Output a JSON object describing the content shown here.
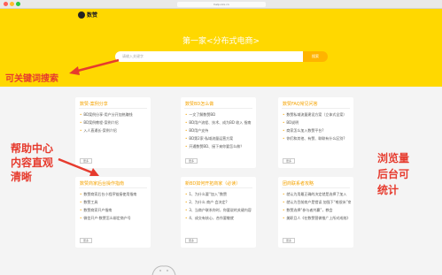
{
  "browser": {
    "url": "help.xxx.cn"
  },
  "header": {
    "logo_text": "数赞"
  },
  "hero": {
    "title": "第一家<分布式电商>",
    "search_placeholder": "请输入关键字",
    "search_button": "搜索"
  },
  "cards": [
    {
      "title": "数赞-案例分享",
      "items": [
        "BD案例分享-用户分开加热赚钱",
        "BD案例教程-案例介绍",
        "入人直通长-案例介绍"
      ],
      "more": "更多"
    },
    {
      "title": "数赞BD怎么做",
      "items": [
        "一文了解数赞BD",
        "BD用户流程、技术、成为BD 收入 指南",
        "BD用户支持",
        "BD第2家-私域流量运营方案",
        "开通数赞BD、接下来你要怎么做？"
      ],
      "more": "更多"
    },
    {
      "title": "数赞FAQ常见问答",
      "items": [
        "数赞私域流量建设方案（立体式全案）",
        "BD说明",
        "商家怎么加入数赞平台?",
        "你们和其他、有赞、联联有什么区别?"
      ],
      "more": "更多"
    },
    {
      "title": "数赞商家后台操作指南",
      "items": [
        "数赞商家后台小程序链接使用指南",
        "数赞工具",
        "数赞商家开户指南",
        "微信开户-数赞怎么绑定商户号"
      ],
      "more": "更多"
    },
    {
      "title": "新BD如何开拓商家（必读）",
      "items": [
        "1、为什么要“加入”数赞",
        "2、为什么 商户 会决定?",
        "3、当商户联系你时，你要说的关键内容",
        "4、成交有核心，合作要敬就"
      ],
      "more": "更多"
    },
    {
      "title": "团商联系者攻略",
      "items": [
        "就认为用最正确的决定就是选择了加入",
        "就认为目前商户是错误 加强下“唯很米”商户",
        "数赞选择“参与者共赢”，教会",
        "美职且人《在数赞营做推广上所对成效》"
      ],
      "more": "更多"
    }
  ],
  "annotations": {
    "search_note": "可关键词搜索",
    "help_note": [
      "帮助中心",
      "内容直观",
      "清晰"
    ],
    "stats_note": [
      "浏览量",
      "后台可",
      "统计"
    ]
  },
  "colors": {
    "brand_yellow": "#ffd800",
    "accent_orange": "#f5a300",
    "annotation_red": "#e63b2e"
  }
}
